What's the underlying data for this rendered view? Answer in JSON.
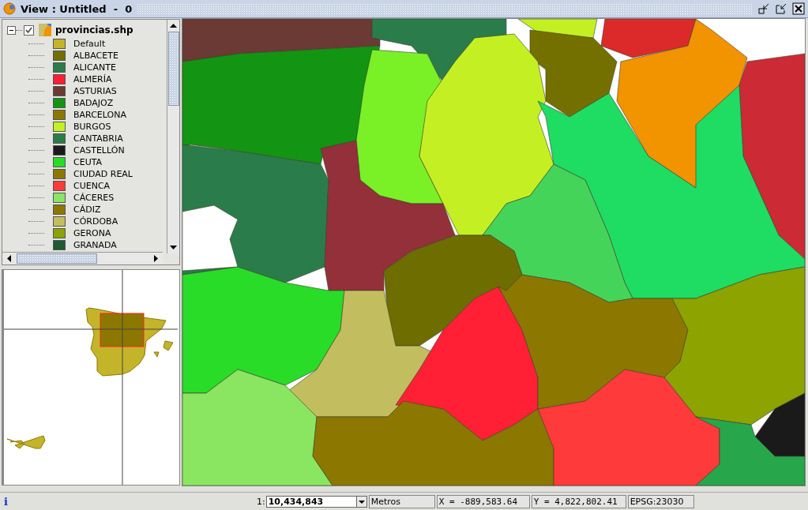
{
  "window": {
    "title": "View : Untitled  -  0"
  },
  "layer": {
    "name": "provincias.shp",
    "checked": true,
    "expanded": true,
    "legend": [
      {
        "label": "Default",
        "color": "#c4b42a"
      },
      {
        "label": "ALBACETE",
        "color": "#747000"
      },
      {
        "label": "ALICANTE",
        "color": "#2a7d4a"
      },
      {
        "label": "ALMERÍA",
        "color": "#ff1e32"
      },
      {
        "label": "ASTURIAS",
        "color": "#6b3a35"
      },
      {
        "label": "BADAJOZ",
        "color": "#139413"
      },
      {
        "label": "BARCELONA",
        "color": "#8c7800"
      },
      {
        "label": "BURGOS",
        "color": "#c4f023"
      },
      {
        "label": "CANTABRIA",
        "color": "#2a7d4a"
      },
      {
        "label": "CASTELLÓN",
        "color": "#1a1a1a"
      },
      {
        "label": "CEUTA",
        "color": "#28dc28"
      },
      {
        "label": "CIUDAD REAL",
        "color": "#8c7800"
      },
      {
        "label": "CUENCA",
        "color": "#ff3a3a"
      },
      {
        "label": "CÁCERES",
        "color": "#8ae660"
      },
      {
        "label": "CÁDIZ",
        "color": "#8c7800"
      },
      {
        "label": "CÓRDOBA",
        "color": "#c2be5f"
      },
      {
        "label": "GERONA",
        "color": "#8ca300"
      },
      {
        "label": "GRANADA",
        "color": "#1d5a32"
      }
    ]
  },
  "status_bar": {
    "info": "i",
    "scale_prefix": "1:",
    "scale": "10,434,843",
    "units": "Metros",
    "x": "X = -889,583.64",
    "y": "Y = 4,822,802.41",
    "crs": "EPSG:23030"
  }
}
